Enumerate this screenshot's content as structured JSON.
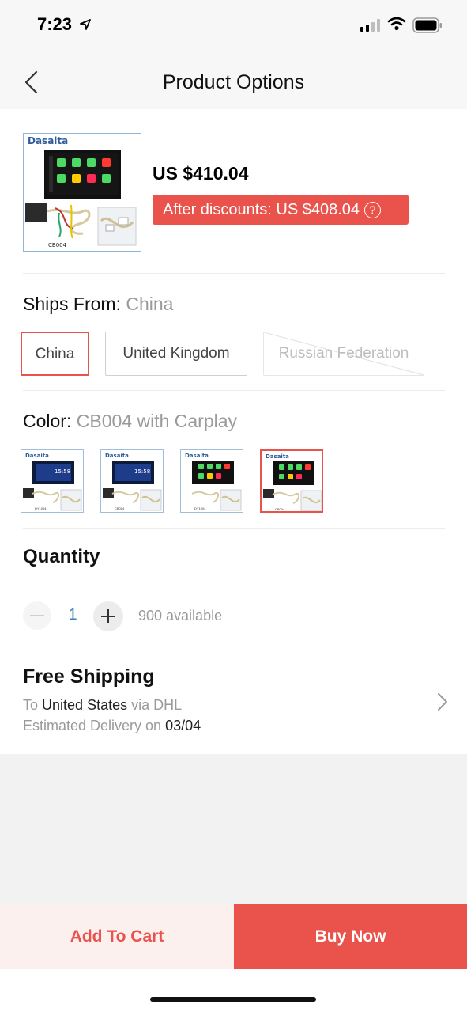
{
  "status_bar": {
    "time": "7:23"
  },
  "nav": {
    "title": "Product Options"
  },
  "product": {
    "price": "US $410.04",
    "discount": "After discounts: US $408.04",
    "brand": "Dasaita",
    "model_code": "CB004",
    "help_glyph": "?"
  },
  "ships_from": {
    "label": "Ships From:",
    "selected": "China",
    "options": [
      {
        "label": "China",
        "state": "selected"
      },
      {
        "label": "United Kingdom",
        "state": "available"
      },
      {
        "label": "Russian Federation",
        "state": "unavailable"
      }
    ]
  },
  "color": {
    "label": "Color:",
    "selected": "CB004 with Carplay",
    "swatches": [
      {
        "brand": "Dasaita",
        "code": "DY1004",
        "selected": false
      },
      {
        "brand": "Dasaita",
        "code": "CB004",
        "selected": false
      },
      {
        "brand": "Dasaita",
        "code": "DY1004",
        "selected": false
      },
      {
        "brand": "Dasaita",
        "code": "CB004",
        "selected": true
      }
    ]
  },
  "quantity": {
    "label": "Quantity",
    "value": "1",
    "available": "900 available"
  },
  "shipping": {
    "title": "Free Shipping",
    "to_prefix": "To",
    "destination": "United States",
    "via_text": "via DHL",
    "delivery_prefix": "Estimated Delivery on",
    "delivery_date": "03/04"
  },
  "actions": {
    "add_to_cart": "Add To Cart",
    "buy_now": "Buy Now"
  },
  "colors": {
    "accent": "#e9534c",
    "qty_blue": "#3a7fbf",
    "muted_text": "#9a9a9a"
  },
  "icons": [
    "location-arrow-icon",
    "signal-icon",
    "wifi-icon",
    "battery-icon",
    "back-icon",
    "help-icon",
    "minus-icon",
    "plus-icon",
    "chevron-right-icon"
  ]
}
